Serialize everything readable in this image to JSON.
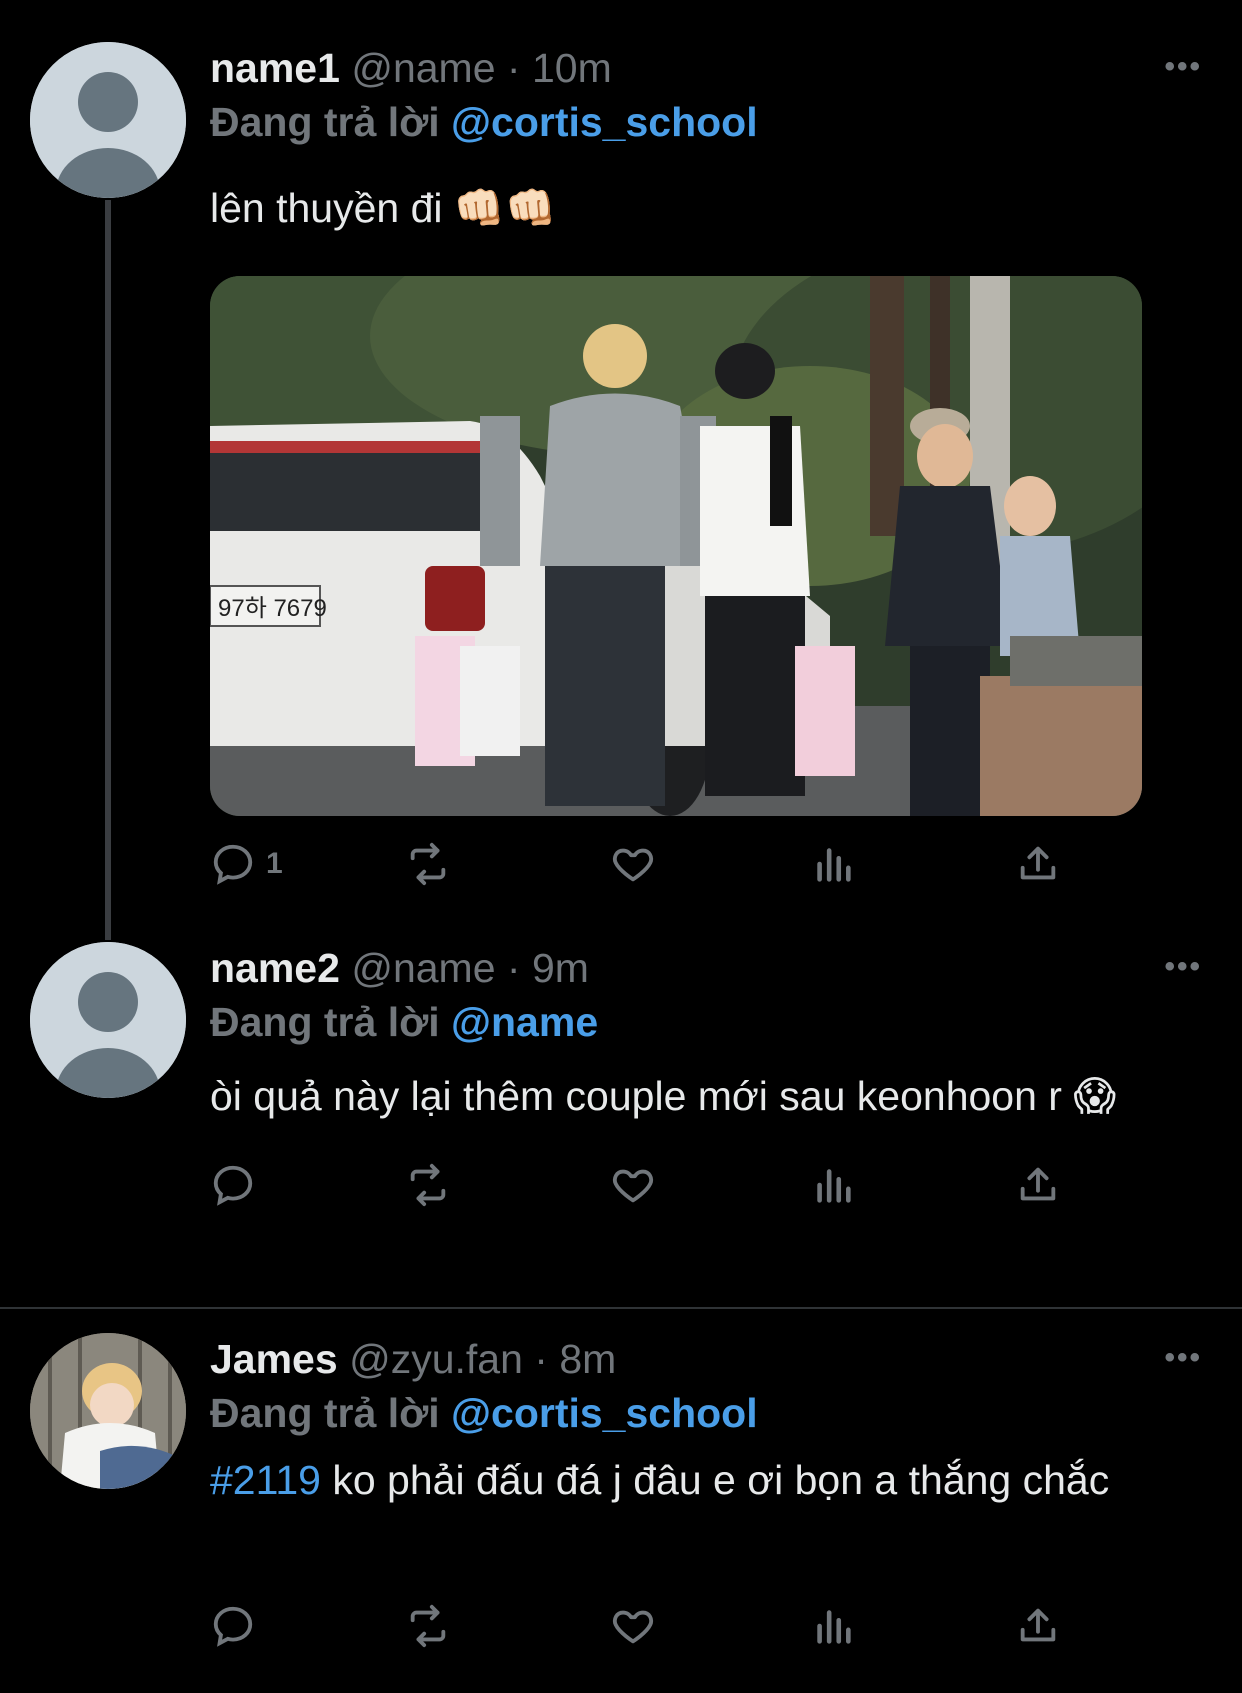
{
  "tweets": [
    {
      "display_name": "name1",
      "handle": "@name",
      "time": "10m",
      "reply_prefix": "Đang trả lời",
      "reply_to": "@cortis_school",
      "text": "lên thuyền đi 👊🏻👊🏻",
      "reply_count": "1",
      "has_photo": true
    },
    {
      "display_name": "name2",
      "handle": "@name",
      "time": "9m",
      "reply_prefix": "Đang trả lời",
      "reply_to": "@name",
      "text": "òi quả này lại thêm couple mới sau keonhoon r 😱",
      "reply_count": ""
    },
    {
      "display_name": "James",
      "handle": "@zyu.fan",
      "time": "8m",
      "reply_prefix": "Đang trả lời",
      "reply_to": "@cortis_school",
      "hashtag": "#2119",
      "text": " ko phải đấu đá j đâu e ơi bọn a thắng chắc",
      "reply_count": ""
    }
  ],
  "separator": "·",
  "more_icon": "more-icon",
  "colors": {
    "background": "#000000",
    "text": "#e7e9ea",
    "muted": "#71767b",
    "link": "#4a9ee8",
    "thread_line": "#3a3d41"
  },
  "photo_description_icon": "photo",
  "license_plate": "97하 7679"
}
